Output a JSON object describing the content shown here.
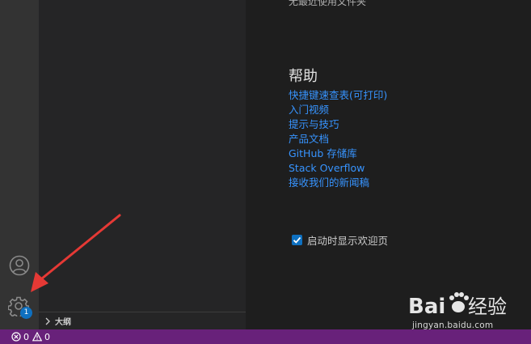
{
  "editor": {
    "recent_cut_text": "无最近使用文件夹",
    "help": {
      "title": "帮助",
      "links": [
        "快捷键速查表(可打印)",
        "入门视频",
        "提示与技巧",
        "产品文档",
        "GitHub 存储库",
        "Stack Overflow",
        "接收我们的新闻稿"
      ]
    },
    "show_on_startup": {
      "label": "启动时显示欢迎页",
      "checked": true
    }
  },
  "sidebar": {
    "outline_label": "大纲"
  },
  "activity_bar": {
    "manage_badge": "1"
  },
  "status_bar": {
    "errors": "0",
    "warnings": "0",
    "color": "#68217a"
  },
  "watermark": {
    "text": "jingyan.baidu.com"
  },
  "colors": {
    "link": "#3794ff",
    "badge": "#0e70c0",
    "arrow": "#e53935"
  }
}
